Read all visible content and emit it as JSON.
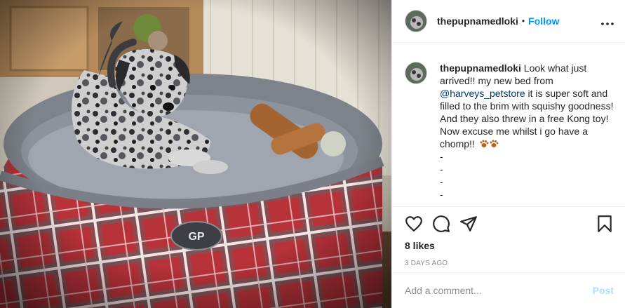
{
  "post": {
    "username": "thepupnamedloki",
    "separator": "•",
    "follow_label": "Follow",
    "more_label": "•••"
  },
  "caption": {
    "username": "thepupnamedloki",
    "text_before": "Look what just arrived!! my new bed from",
    "mention": "@harveys_petstore",
    "text_after": "it is super soft and filled to the brim with squishy goodness! And they also threw in a free Kong toy! Now excuse me whilst i go have a chomp!!",
    "dashes": [
      "-",
      "-",
      "-",
      "-"
    ]
  },
  "engagement": {
    "likes": "8 likes",
    "time": "3 DAYS AGO"
  },
  "comment_box": {
    "placeholder": "Add a comment...",
    "post_label": "Post"
  },
  "icons": {
    "like": "heart-icon",
    "comment": "comment-icon",
    "share": "paper-plane-icon",
    "save": "bookmark-icon",
    "emoji": "paw-prints-emoji"
  },
  "colors": {
    "link_blue": "#0095f6",
    "mention": "#00376b",
    "post_disabled": "#b2dffc",
    "secondary_text": "#8e8e8e",
    "bed_red": "#b8323a"
  },
  "photo": {
    "bed_logo": "GP"
  }
}
